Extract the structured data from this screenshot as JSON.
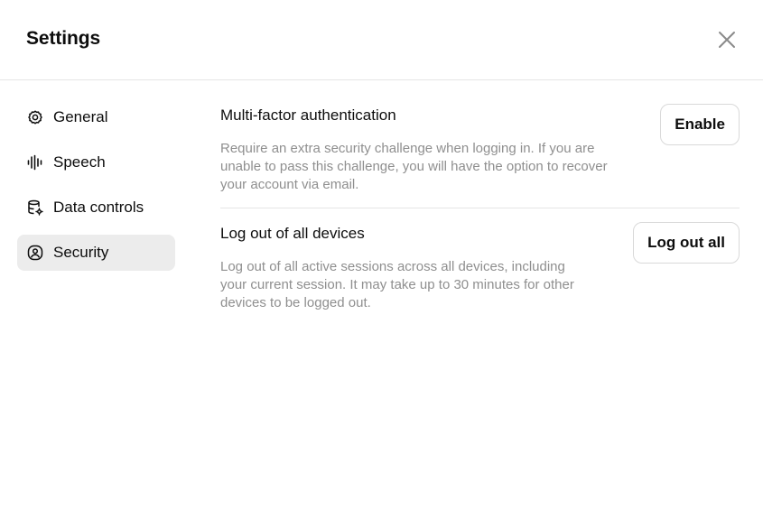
{
  "dialog": {
    "title": "Settings",
    "close_icon": "close-icon"
  },
  "sidebar": {
    "items": [
      {
        "label": "General",
        "icon": "gear-icon",
        "active": false
      },
      {
        "label": "Speech",
        "icon": "waveform-icon",
        "active": false
      },
      {
        "label": "Data controls",
        "icon": "database-gear-icon",
        "active": false
      },
      {
        "label": "Security",
        "icon": "shield-user-icon",
        "active": true
      }
    ]
  },
  "security": {
    "mfa": {
      "title": "Multi-factor authentication",
      "description_lines": [
        "Require an extra security challenge when logging in. If you are",
        "unable to pass this challenge, you will have the option to recover",
        "your account via email."
      ],
      "button_label": "Enable"
    },
    "logout": {
      "title": "Log out of all devices",
      "description_lines": [
        "Log out of all active sessions across all devices, including",
        "your current session. It may take up to 30 minutes for other",
        "devices to be logged out."
      ],
      "button_label": "Log out all"
    }
  },
  "colors": {
    "active_nav_bg": "#ececec",
    "muted_text": "#8f8f8f",
    "divider": "#e5e5e5"
  }
}
